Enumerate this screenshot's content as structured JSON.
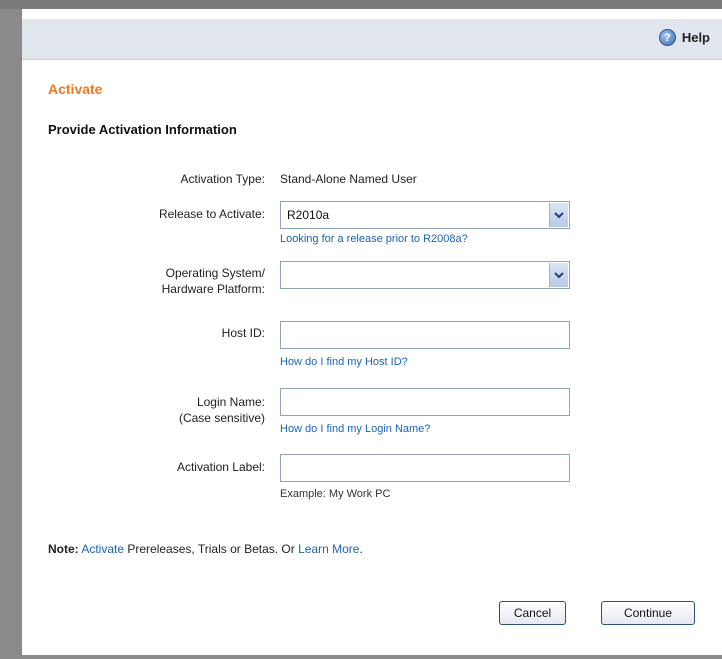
{
  "toolbar": {
    "help_label": "Help",
    "help_icon": "question-circle-icon"
  },
  "page": {
    "title": "Activate",
    "section_title": "Provide Activation Information"
  },
  "form": {
    "activation_type": {
      "label": "Activation Type:",
      "value": "Stand-Alone Named User"
    },
    "release": {
      "label": "Release to Activate:",
      "value": "R2010a",
      "link": "Looking for a release prior to R2008a?"
    },
    "os": {
      "label_line1": "Operating System/",
      "label_line2": "Hardware Platform:",
      "value": ""
    },
    "host_id": {
      "label": "Host ID:",
      "value": "",
      "link": "How do I find my Host ID?"
    },
    "login": {
      "label_line1": "Login Name:",
      "label_line2": "(Case sensitive)",
      "value": "",
      "link": "How do I find my Login Name?"
    },
    "activation_label": {
      "label": "Activation Label:",
      "value": "",
      "hint": "Example: My Work PC"
    }
  },
  "note": {
    "prefix": "Note:",
    "link1": "Activate",
    "middle": " Prereleases, Trials or Betas. Or ",
    "link2": "Learn More",
    "suffix": "."
  },
  "buttons": {
    "cancel": "Cancel",
    "continue": "Continue"
  },
  "colors": {
    "title": "#f07a1f",
    "link": "#1a63b5",
    "toolbar": "#e1e6ee"
  }
}
